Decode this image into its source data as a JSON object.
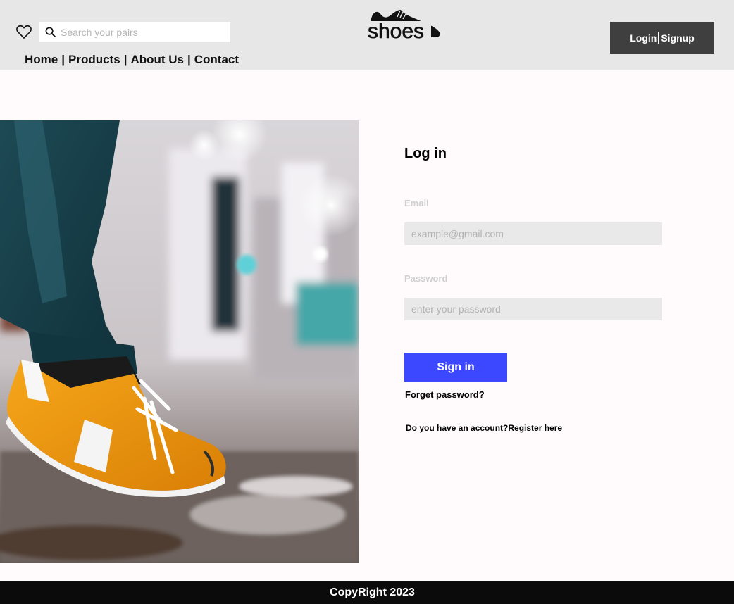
{
  "header": {
    "search": {
      "placeholder": "Search your pairs",
      "value": ""
    },
    "nav": {
      "items": [
        "Home",
        "Products",
        "About Us",
        "Contact"
      ],
      "separator": "|"
    },
    "logo_text": "shoes",
    "auth": {
      "login_label": "Login",
      "signup_label": "Signup"
    },
    "icons": {
      "wishlist": "heart-icon",
      "search": "search-icon"
    },
    "colors": {
      "background": "#e7e7e7",
      "auth_button": "#3f3f3f"
    }
  },
  "hero": {
    "icon": "sneakers-photo"
  },
  "login": {
    "title": "Log in",
    "email": {
      "label": "Email",
      "placeholder": "example@gmail.com",
      "value": ""
    },
    "password": {
      "label": "Password",
      "placeholder": "enter your password",
      "value": ""
    },
    "signin_label": "Sign in",
    "forgot_label": "Forget password?",
    "register_prompt": "Do you have an account?",
    "register_link": "Register here",
    "colors": {
      "signin_button": "#3b48ff",
      "label": "#cfcfcf",
      "input": "#e9e9e9"
    }
  },
  "footer": {
    "copyright": "CopyRight 2023",
    "background": "#0b0b0b"
  }
}
